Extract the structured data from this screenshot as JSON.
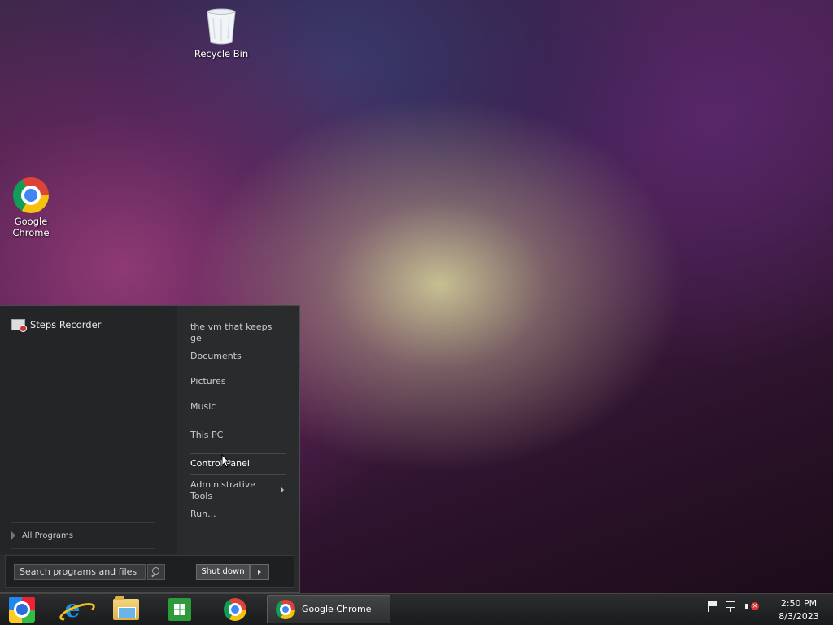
{
  "desktop": {
    "icons": [
      {
        "label": "Recycle Bin",
        "icon": "recycle-bin-icon"
      },
      {
        "label": "Google Chrome",
        "label_line1": "Google",
        "label_line2": "Chrome",
        "icon": "chrome-icon"
      }
    ]
  },
  "start_menu": {
    "programs": [
      {
        "label": "Steps Recorder",
        "icon": "steps-recorder-icon"
      }
    ],
    "all_programs": "All Programs",
    "right_items": [
      {
        "label_line1": "the vm that keeps",
        "label_line2": "ge"
      },
      {
        "label": "Documents"
      },
      {
        "label": "Pictures"
      },
      {
        "label": "Music"
      },
      {
        "label": "This PC"
      },
      {
        "label": "Control Panel"
      },
      {
        "label_line1": "Administrative",
        "label_line2": "Tools",
        "has_submenu": true
      },
      {
        "label": "Run..."
      }
    ],
    "search_placeholder": "Search programs and files",
    "shutdown_label": "Shut down"
  },
  "taskbar": {
    "pinned": [
      "start-orb",
      "internet-explorer-icon",
      "file-explorer-icon",
      "store-icon",
      "chrome-icon"
    ],
    "active_window": "Google Chrome",
    "tray_icons": [
      "action-center-flag-icon",
      "network-icon",
      "volume-muted-icon"
    ],
    "clock": {
      "time": "2:50 PM",
      "date": "8/3/2023"
    }
  },
  "colors": {
    "menu_bg": "#2a2b2c",
    "taskbar_bg": "#1a1b1c",
    "accent_text": "#ffffff"
  }
}
